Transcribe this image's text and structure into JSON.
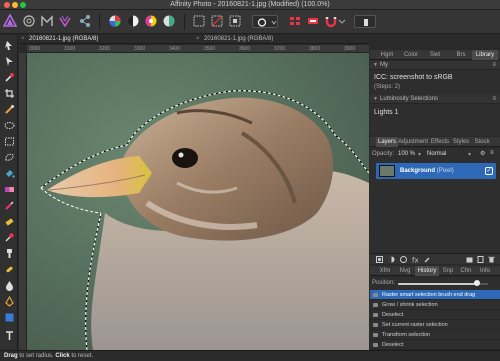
{
  "window": {
    "title": "Affinity Photo - 20160821-1.jpg (Modified) (100.0%)"
  },
  "colors": {
    "accent": "#2d69b7",
    "canvas_bg": "#5a6f5d",
    "panel_bg": "#2e2e2e"
  },
  "doc_tabs": [
    {
      "label": "20160821-1.jpg (RGBA/8)",
      "active": true
    },
    {
      "label": "20160821-1.jpg (RGBA/8)",
      "active": false
    }
  ],
  "ruler": {
    "ticks": [
      "3000",
      "3100",
      "3200",
      "3300",
      "3400",
      "3500",
      "3600",
      "3700",
      "3800",
      "3900"
    ]
  },
  "top_panel": {
    "tabs": [
      "Hgm",
      "Color",
      "Swt",
      "Brs",
      "Library"
    ],
    "active_tab": "Library",
    "my_section": "My",
    "macro_name": "ICC: screenshot to sRGB",
    "macro_steps": "(Steps: 2)",
    "lum_section": "Luminosity Selections",
    "lum_item": "Lights 1"
  },
  "layers_panel": {
    "tabs": [
      "Layers",
      "Adjustment",
      "Effects",
      "Styles",
      "Stock"
    ],
    "active_tab": "Layers",
    "opacity_label": "Opacity:",
    "opacity_value": "100 %",
    "blend_mode": "Normal",
    "layer": {
      "name": "Background",
      "type": "(Pixel)",
      "visible": true
    }
  },
  "history_panel": {
    "tabs": [
      "Xfm",
      "Nvg",
      "History",
      "Snp",
      "Chn",
      "Info"
    ],
    "active_tab": "History",
    "position_label": "Position:",
    "position": 0.88,
    "items": [
      {
        "label": "Raster smart selection brush end drag",
        "active": true
      },
      {
        "label": "Grow / shrink selection",
        "active": false
      },
      {
        "label": "Deselect",
        "active": false
      },
      {
        "label": "Set current raster selection",
        "active": false
      },
      {
        "label": "Transform selection",
        "active": false
      },
      {
        "label": "Deselect",
        "active": false
      }
    ]
  },
  "status": {
    "drag": "Drag",
    "text1": " to set radius. ",
    "click": "Click",
    "text2": " to reset."
  }
}
